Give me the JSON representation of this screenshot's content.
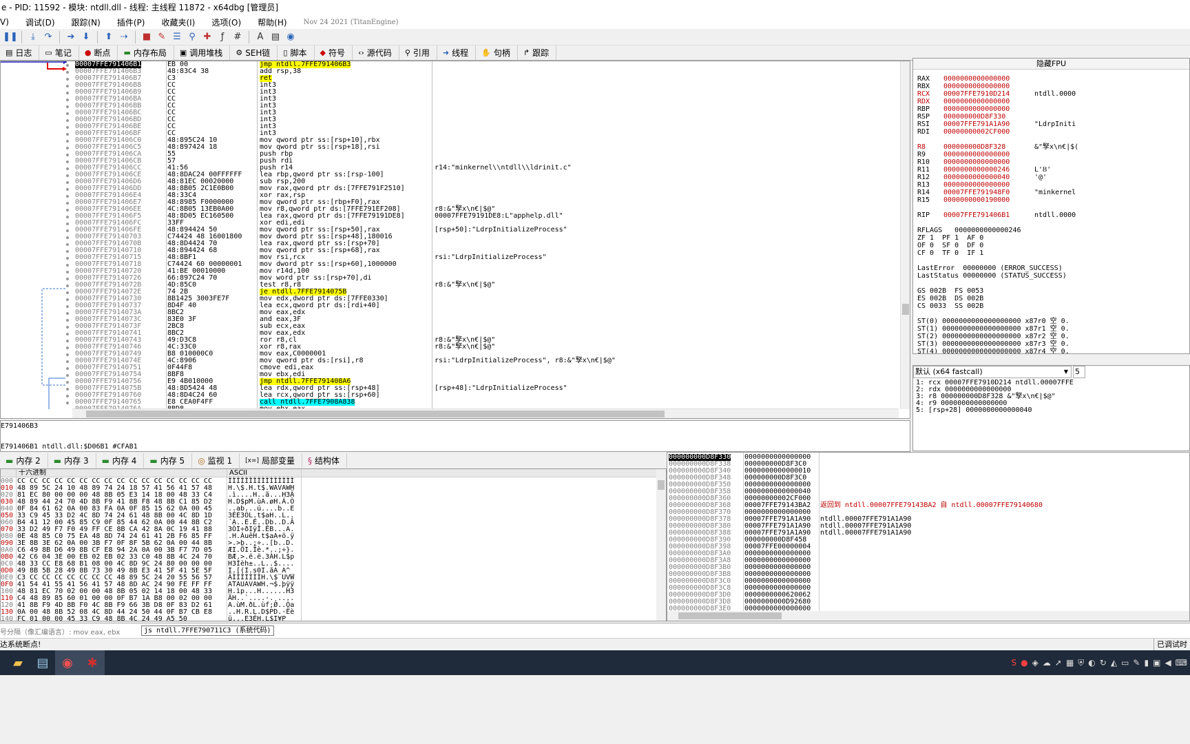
{
  "title": "e - PID: 11592 - 模块: ntdll.dll - 线程: 主线程 11872 - x64dbg [管理员]",
  "menu": [
    "V)",
    "调试(D)",
    "跟踪(N)",
    "插件(P)",
    "收藏夹(I)",
    "选项(O)",
    "帮助(H)"
  ],
  "menu_date": "Nov 24 2021 (TitanEngine)",
  "tabs": [
    {
      "label": "日志",
      "icon": "log-icon"
    },
    {
      "label": "笔记",
      "icon": "notes-icon"
    },
    {
      "label": "断点",
      "icon": "breakpoint-icon"
    },
    {
      "label": "内存布局",
      "icon": "memory-map-icon"
    },
    {
      "label": "调用堆栈",
      "icon": "call-stack-icon"
    },
    {
      "label": "SEH链",
      "icon": "seh-icon"
    },
    {
      "label": "脚本",
      "icon": "script-icon"
    },
    {
      "label": "符号",
      "icon": "symbols-icon"
    },
    {
      "label": "源代码",
      "icon": "source-icon"
    },
    {
      "label": "引用",
      "icon": "references-icon"
    },
    {
      "label": "线程",
      "icon": "threads-icon"
    },
    {
      "label": "句柄",
      "icon": "handles-icon"
    },
    {
      "label": "跟踪",
      "icon": "trace-icon"
    }
  ],
  "disasm": [
    [
      "00007FFE791406B1",
      "EB 00",
      "jmp ntdll.7FFE791406B3",
      ""
    ],
    [
      "00007FFE791406B3",
      "48:83C4 38",
      "add rsp,38",
      ""
    ],
    [
      "00007FFE791406B7",
      "C3",
      "ret",
      ""
    ],
    [
      "00007FFE791406B8",
      "CC",
      "int3",
      ""
    ],
    [
      "00007FFE791406B9",
      "CC",
      "int3",
      ""
    ],
    [
      "00007FFE791406BA",
      "CC",
      "int3",
      ""
    ],
    [
      "00007FFE791406BB",
      "CC",
      "int3",
      ""
    ],
    [
      "00007FFE791406BC",
      "CC",
      "int3",
      ""
    ],
    [
      "00007FFE791406BD",
      "CC",
      "int3",
      ""
    ],
    [
      "00007FFE791406BE",
      "CC",
      "int3",
      ""
    ],
    [
      "00007FFE791406BF",
      "CC",
      "int3",
      ""
    ],
    [
      "00007FFE791406C0",
      "48:895C24 10",
      "mov qword ptr ss:[rsp+10],rbx",
      ""
    ],
    [
      "00007FFE791406C5",
      "48:897424 18",
      "mov qword ptr ss:[rsp+18],rsi",
      ""
    ],
    [
      "00007FFE791406CA",
      "55",
      "push rbp",
      ""
    ],
    [
      "00007FFE791406CB",
      "57",
      "push rdi",
      ""
    ],
    [
      "00007FFE791406CC",
      "41:56",
      "push r14",
      "r14:\"minkernel\\\\ntdll\\\\ldrinit.c\""
    ],
    [
      "00007FFE791406CE",
      "48:8DAC24 00FFFFFF",
      "lea rbp,qword ptr ss:[rsp-100]",
      ""
    ],
    [
      "00007FFE791406D6",
      "48:81EC 00020000",
      "sub rsp,200",
      ""
    ],
    [
      "00007FFE791406DD",
      "48:8B05 2C1E0B00",
      "mov rax,qword ptr ds:[7FFE791F2510]",
      ""
    ],
    [
      "00007FFE791406E4",
      "48:33C4",
      "xor rax,rsp",
      ""
    ],
    [
      "00007FFE791406E7",
      "48:8985 F0000000",
      "mov qword ptr ss:[rbp+F0],rax",
      ""
    ],
    [
      "00007FFE791406EE",
      "4C:8B05 13EB0A00",
      "mov r8,qword ptr ds:[7FFE791EF208]",
      "r8:&\"孯x\\n€|$@\""
    ],
    [
      "00007FFE791406F5",
      "48:8D05 EC160500",
      "lea rax,qword ptr ds:[7FFE79191DE8]",
      "00007FFE79191DE8:L\"apphelp.dll\""
    ],
    [
      "00007FFE791406FC",
      "33FF",
      "xor edi,edi",
      ""
    ],
    [
      "00007FFE791406FE",
      "48:894424 50",
      "mov qword ptr ss:[rsp+50],rax",
      "[rsp+50]:\"LdrpInitializeProcess\""
    ],
    [
      "00007FFE79140703",
      "C74424 48 16001800",
      "mov dword ptr ss:[rsp+48],180016",
      ""
    ],
    [
      "00007FFE7914070B",
      "48:8D4424 70",
      "lea rax,qword ptr ss:[rsp+70]",
      ""
    ],
    [
      "00007FFE79140710",
      "48:894424 68",
      "mov qword ptr ss:[rsp+68],rax",
      ""
    ],
    [
      "00007FFE79140715",
      "48:8BF1",
      "mov rsi,rcx",
      "rsi:\"LdrpInitializeProcess\""
    ],
    [
      "00007FFE79140718",
      "C74424 60 00000001",
      "mov dword ptr ss:[rsp+60],1000000",
      ""
    ],
    [
      "00007FFE79140720",
      "41:BE 00010000",
      "mov r14d,100",
      ""
    ],
    [
      "00007FFE79140726",
      "66:897C24 70",
      "mov word ptr ss:[rsp+70],di",
      ""
    ],
    [
      "00007FFE7914072B",
      "4D:85C0",
      "test r8,r8",
      "r8:&\"孯x\\n€|$@\""
    ],
    [
      "00007FFE7914072E",
      "74 2B",
      "je ntdll.7FFE7914075B",
      ""
    ],
    [
      "00007FFE79140730",
      "8B1425 3003FE7F",
      "mov edx,dword ptr ds:[7FFE0330]",
      ""
    ],
    [
      "00007FFE79140737",
      "8D4F 40",
      "lea ecx,qword ptr ds:[rdi+40]",
      ""
    ],
    [
      "00007FFE7914073A",
      "8BC2",
      "mov eax,edx",
      ""
    ],
    [
      "00007FFE7914073C",
      "83E0 3F",
      "and eax,3F",
      ""
    ],
    [
      "00007FFE7914073F",
      "2BC8",
      "sub ecx,eax",
      ""
    ],
    [
      "00007FFE79140741",
      "8BC2",
      "mov eax,edx",
      ""
    ],
    [
      "00007FFE79140743",
      "49:D3C8",
      "ror r8,cl",
      "r8:&\"孯x\\n€|$@\""
    ],
    [
      "00007FFE79140746",
      "4C:33C0",
      "xor r8,rax",
      "r8:&\"孯x\\n€|$@\""
    ],
    [
      "00007FFE79140749",
      "B8 010000C0",
      "mov eax,C0000001",
      ""
    ],
    [
      "00007FFE7914074E",
      "4C:8906",
      "mov qword ptr ds:[rsi],r8",
      "rsi:\"LdrpInitializeProcess\", r8:&\"孯x\\n€|$@\""
    ],
    [
      "00007FFE79140751",
      "0F44F8",
      "cmove edi,eax",
      ""
    ],
    [
      "00007FFE79140754",
      "8BF8",
      "mov ebx,edi",
      ""
    ],
    [
      "00007FFE79140756",
      "E9 4B010000",
      "jmp ntdll.7FFE791408A6",
      ""
    ],
    [
      "00007FFE7914075B",
      "48:8D5424 48",
      "lea rdx,qword ptr ss:[rsp+48]",
      "[rsp+48]:\"LdrpInitializeProcess\""
    ],
    [
      "00007FFE79140760",
      "48:8D4C24 60",
      "lea rcx,qword ptr ss:[rsp+60]",
      ""
    ],
    [
      "00007FFE79140765",
      "E8 CEA0F4FF",
      "call ntdll.7FFE7908A838",
      ""
    ],
    [
      "00007FFE7914076A",
      "8BD8",
      "mov ebx,eax",
      ""
    ]
  ],
  "registers": {
    "header": "隐藏FPU",
    "general": [
      [
        "RAX",
        "0000000000000000",
        ""
      ],
      [
        "RBX",
        "0000000000000000",
        ""
      ],
      [
        "RCX",
        "00007FFE7910D214",
        "ntdll.0000"
      ],
      [
        "RDX",
        "0000000000000000",
        ""
      ],
      [
        "RBP",
        "0000000000000000",
        ""
      ],
      [
        "RSP",
        "000000000D8F330",
        ""
      ],
      [
        "RSI",
        "00007FFE791A1A90",
        "\"LdrpIniti"
      ],
      [
        "RDI",
        "00000000002CF000",
        ""
      ],
      [
        "R8",
        "000000000D8F328",
        "&\"孯x\\n€|$("
      ],
      [
        "R9",
        "0000000000000000",
        ""
      ],
      [
        "R10",
        "0000000000000000",
        ""
      ],
      [
        "R11",
        "0000000000000246",
        "L'Ȣ'"
      ],
      [
        "R12",
        "0000000000000040",
        "'@'"
      ],
      [
        "R13",
        "0000000000000000",
        ""
      ],
      [
        "R14",
        "00007FFE791948F0",
        "\"minkernel"
      ],
      [
        "R15",
        "0000000000190000",
        ""
      ]
    ],
    "rip": [
      "RIP",
      "00007FFE791406B1",
      "ntdll.0000"
    ],
    "flags": [
      "RFLAGS   0000000000000246",
      "ZF 1  PF 1  AF 0",
      "OF 0  SF 0  DF 0",
      "CF 0  TF 0  IF 1"
    ],
    "errors": [
      "LastError  00000000 (ERROR_SUCCESS)",
      "LastStatus 00000000 (STATUS_SUCCESS)"
    ],
    "segs": [
      "GS 002B  FS 0053",
      "ES 002B  DS 002B",
      "CS 0033  SS 002B"
    ],
    "fpu": [
      "ST(0) 0000000000000000000 x87r0 空 0.",
      "ST(1) 0000000000000000000 x87r1 空 0.",
      "ST(2) 0000000000000000000 x87r2 空 0.",
      "ST(3) 0000000000000000000 x87r3 空 0.",
      "ST(4) 0000000000000000000 x87r4 空 0."
    ]
  },
  "callconv": {
    "selected": "默认 (x64 fastcall)",
    "count": "5",
    "args": [
      "1: rcx 00007FFE7910D214 ntdll.00007FFE",
      "2: rdx 0000000000000000",
      "3: r8 000000000D8F328 &\"孯x\\n€|$@\"",
      "4: r9 0000000000000000",
      "5: [rsp+28] 0000000000000040"
    ]
  },
  "info": {
    "line1": "E791406B3",
    "line2": "E791406B1 ntdll.dll:$D06B1 #CFAB1"
  },
  "dump_tabs": [
    {
      "label": "内存 2",
      "icon": "memory-icon"
    },
    {
      "label": "内存 3",
      "icon": "memory-icon"
    },
    {
      "label": "内存 4",
      "icon": "memory-icon"
    },
    {
      "label": "内存 5",
      "icon": "memory-icon"
    },
    {
      "label": "监视 1",
      "icon": "watch-icon"
    },
    {
      "label": "局部变量",
      "icon": "locals-icon"
    },
    {
      "label": "结构体",
      "icon": "struct-icon"
    }
  ],
  "dump_header": {
    "hex": "十六进制",
    "ascii": "ASCII"
  },
  "dump": [
    [
      "000",
      "CC CC CC CC CC CC CC CC CC CC CC CC CC CC CC CC",
      "ÌÌÌÌÌÌÌÌÌÌÌÌÌÌÌÌ"
    ],
    [
      "010",
      "48 89 5C 24 10 48 89 74 24 18 57 41 56 41 57 48",
      "H.\\$.H.t$.WAVAWH"
    ],
    [
      "020",
      "81 EC 80 00 00 00 48 8B 05 E3 14 18 00 48 33 C4",
      ".ì....H..ã...H3Ä"
    ],
    [
      "030",
      "48 89 44 24 70 4D 8B F9 41 8B F8 48 8B C1 85 D2",
      "H.D$pM.ùA.øH.Á.Ò"
    ],
    [
      "040",
      "0F 84 61 62 0A 00 83 FA 0A 0F 85 15 62 0A 00 45",
      "..ab...ú....b..E"
    ],
    [
      "050",
      "33 C9 45 33 D2 4C 8D 74 24 61 48 8B 00 4C 8D 1D",
      "3ÉE3ÒL.t$aH..L.."
    ],
    [
      "060",
      "B4 41 12 00 45 85 C9 0F 85 44 62 0A 00 44 8B C2",
      "´A..E.É..Db..D.Â"
    ],
    [
      "070",
      "33 D2 49 F7 F0 49 FF CE 8B CA 42 8A 0C 19 41 88",
      "3ÒI÷ðIÿÎ.ÊB...A."
    ],
    [
      "080",
      "0E 48 85 C0 75 EA 48 8D 74 24 61 41 2B F6 85 FF",
      ".H.ÀuêH.t$aA+ö.ÿ"
    ],
    [
      "090",
      "3E 8B 3E 62 0A 00 3B F7 0F 8F 5B 62 0A 00 44 8B",
      ">.>b..;÷..[b..D."
    ],
    [
      "0A0",
      "C6 49 8B D6 49 8B CF E8 94 2A 0A 00 3B F7 7D 05",
      "ÆI.ÖI.Ïè.*..;÷}."
    ],
    [
      "0B0",
      "42 C6 04 3E 00 EB 02 EB 02 33 C0 48 8B 4C 24 70",
      "BÆ.>.ë.ë.3ÀH.L$p"
    ],
    [
      "0C0",
      "48 33 CC E8 68 B1 08 00 4C 8D 9C 24 80 00 00 00",
      "H3Ìèh±..L..$...."
    ],
    [
      "0D0",
      "49 8B 5B 28 49 8B 73 30 49 8B E3 41 5F 41 5E 5F",
      "I.[(I.s0I.ãA_A^_"
    ],
    [
      "0E0",
      "C3 CC CC CC CC CC CC CC 48 89 5C 24 20 55 56 57",
      "ÃÌÌÌÌÌÌÌH.\\$ UVW"
    ],
    [
      "0F0",
      "41 54 41 55 41 56 41 57 48 8D AC 24 90 FE FF FF",
      "ATAUAVAWH.¬$.þÿÿ"
    ],
    [
      "100",
      "48 81 EC 70 02 00 00 48 8B 05 02 14 18 00 48 33",
      "H.ìp...H......H3"
    ],
    [
      "110",
      "C4 48 89 85 60 01 00 00 0F B7 1A B8 00 02 00 00",
      "ÄH..`....·.¸...."
    ],
    [
      "120",
      "41 8B F9 4D 8B F0 4C 8B F9 66 3B D8 0F 83 D2 61",
      "A.ùM.ðL.ùf;Ø..Òa"
    ],
    [
      "130",
      "0A 00 48 8B 52 08 4C 8D 44 24 50 44 0F B7 CB E8",
      "..H.R.L.D$PD.·Ëè"
    ],
    [
      "140",
      "FC 01 00 00 45 33 C9 48 8B 4C 24 49 A5 50",
      "ü...E3ÉH.L$I¥P"
    ]
  ],
  "stack": [
    [
      "000000000D8F330",
      "0000000000000000",
      ""
    ],
    [
      "000000000D8F338",
      "000000000D8F3C0",
      ""
    ],
    [
      "000000000D8F340",
      "0000000000000010",
      ""
    ],
    [
      "000000000D8F348",
      "000000000D8F3C0",
      ""
    ],
    [
      "000000000D8F350",
      "0000000000000000",
      ""
    ],
    [
      "000000000D8F358",
      "0000000000000040",
      ""
    ],
    [
      "000000000D8F360",
      "00000000002CF000",
      ""
    ],
    [
      "000000000D8F368",
      "00007FFE79143BA2",
      "返回到 ntdll.00007FFE79143BA2 自 ntdll.00007FFE79140680"
    ],
    [
      "000000000D8F370",
      "0000000000000000",
      ""
    ],
    [
      "000000000D8F378",
      "00007FFE791A1A90",
      "ntdll.00007FFE791A1A90"
    ],
    [
      "000000000D8F380",
      "00007FFE791A1A90",
      "ntdll.00007FFE791A1A90"
    ],
    [
      "000000000D8F388",
      "00007FFE791A1A90",
      "ntdll.00007FFE791A1A90"
    ],
    [
      "000000000D8F390",
      "000000000D8F458",
      ""
    ],
    [
      "000000000D8F398",
      "00007FFE00000004",
      ""
    ],
    [
      "000000000D8F3A0",
      "0000000000000000",
      ""
    ],
    [
      "000000000D8F3A8",
      "0000000000000000",
      ""
    ],
    [
      "000000000D8F3B0",
      "0000000000000000",
      ""
    ],
    [
      "000000000D8F3B8",
      "0000000000000000",
      ""
    ],
    [
      "000000000D8F3C0",
      "0000000000000000",
      ""
    ],
    [
      "000000000D8F3C8",
      "0000000000000000",
      ""
    ],
    [
      "000000000D8F3D0",
      "0000000000620062",
      ""
    ],
    [
      "000000000D8F3D8",
      "0000000000D92680",
      ""
    ],
    [
      "000000000D8F3E0",
      "0000000000000000",
      ""
    ]
  ],
  "cmd": {
    "label": "号分隔（像汇编语言）: mov eax, ebx",
    "tip": "js ntdll.7FFE790711C3 (系统代码)"
  },
  "status": {
    "left": "达系统断点!",
    "right": "已调试时"
  },
  "colors": {
    "yellow": "#ffff00",
    "cyan": "#00ffff",
    "red": "#c00000",
    "addr": "#808080"
  }
}
